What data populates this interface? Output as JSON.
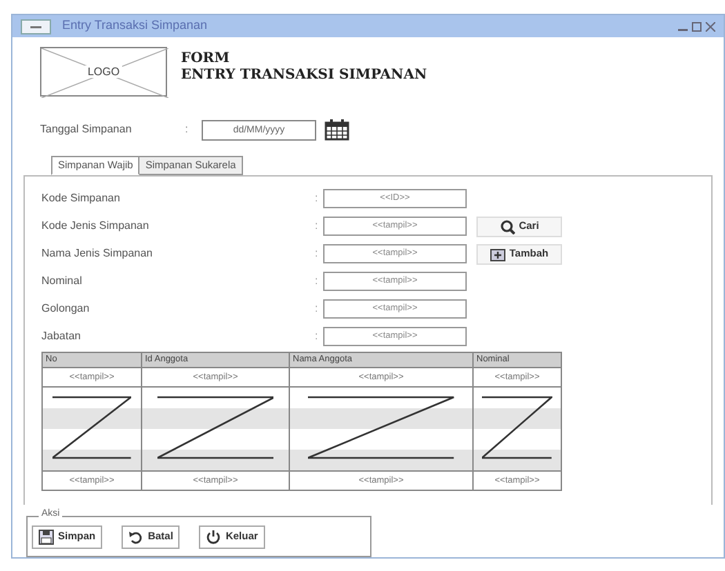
{
  "window": {
    "title": "Entry Transaksi Simpanan"
  },
  "header": {
    "logo": "LOGO",
    "title_lines": [
      "FORM",
      "ENTRY TRANSAKSI SIMPANAN"
    ]
  },
  "date_field": {
    "label": "Tanggal Simpanan",
    "separator": ":",
    "placeholder": "dd/MM/yyyy"
  },
  "tabs": [
    {
      "label": "Simpanan Wajib",
      "selected": true
    },
    {
      "label": "Simpanan Sukarela",
      "selected": false
    }
  ],
  "fields": [
    {
      "label": "Kode Simpanan",
      "separator": ":",
      "value": "<<ID>>"
    },
    {
      "label": "Kode Jenis Simpanan",
      "separator": ":",
      "value": "<<tampil>>",
      "button": {
        "label": "Cari"
      }
    },
    {
      "label": "Nama Jenis Simpanan",
      "separator": ":",
      "value": "<<tampil>>",
      "button": {
        "label": "Tambah"
      }
    },
    {
      "label": "Nominal",
      "separator": ":",
      "value": "<<tampil>>"
    },
    {
      "label": "Golongan",
      "separator": ":",
      "value": "<<tampil>>"
    },
    {
      "label": "Jabatan",
      "separator": ":",
      "value": "<<tampil>>"
    }
  ],
  "table": {
    "columns": [
      "No",
      "Id Anggota",
      "Nama Anggota",
      "Nominal"
    ],
    "rows": [
      {
        "kind": "cells",
        "cells": [
          "<<tampil>>",
          "<<tampil>>",
          "<<tampil>>",
          "<<tampil>>"
        ]
      },
      {
        "kind": "filler"
      },
      {
        "kind": "cells",
        "cells": [
          "<<tampil>>",
          "<<tampil>>",
          "<<tampil>>",
          "<<tampil>>"
        ]
      }
    ]
  },
  "actions": {
    "title": "Aksi",
    "buttons": [
      {
        "label": "Simpan"
      },
      {
        "label": "Batal"
      },
      {
        "label": "Keluar"
      }
    ]
  }
}
